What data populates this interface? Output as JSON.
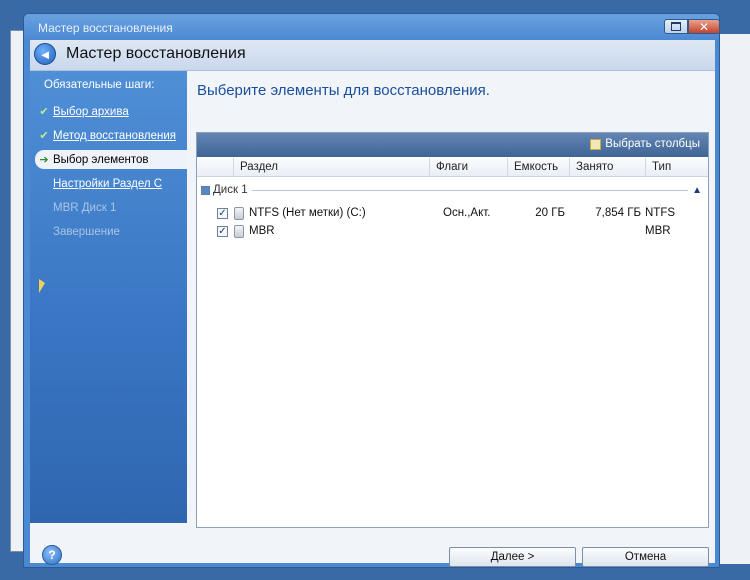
{
  "window": {
    "titlebar_title": "Мастер восстановления",
    "header_title": "Мастер восстановления"
  },
  "sidebar": {
    "heading": "Обязательные шаги:",
    "items": [
      {
        "label": "Выбор архива",
        "state": "done"
      },
      {
        "label": "Метод восстановления",
        "state": "done"
      },
      {
        "label": "Выбор элементов",
        "state": "current"
      },
      {
        "label": "Настройки Раздел C",
        "state": "next"
      },
      {
        "label": "MBR Диск 1",
        "state": "disabled"
      },
      {
        "label": "Завершение",
        "state": "disabled"
      }
    ]
  },
  "main": {
    "title": "Выберите элементы для восстановления.",
    "select_columns_label": "Выбрать столбцы",
    "columns": [
      "Раздел",
      "Флаги",
      "Емкость",
      "Занято",
      "Тип"
    ],
    "group_label": "Диск 1",
    "rows": [
      {
        "name": "NTFS (Нет метки) (C:)",
        "flags": "Осн.,Акт.",
        "capacity": "20 ГБ",
        "used": "7,854 ГБ",
        "type": "NTFS",
        "checked": true
      },
      {
        "name": "MBR",
        "flags": "",
        "capacity": "",
        "used": "",
        "type": "MBR",
        "checked": true
      }
    ]
  },
  "footer": {
    "next_label": "Далее >",
    "cancel_label": "Отмена"
  },
  "colors": {
    "sidebar_blue": "#3a76c4",
    "title_blue": "#1a4f9c",
    "toolbar_blue": "#4b6f9f"
  }
}
